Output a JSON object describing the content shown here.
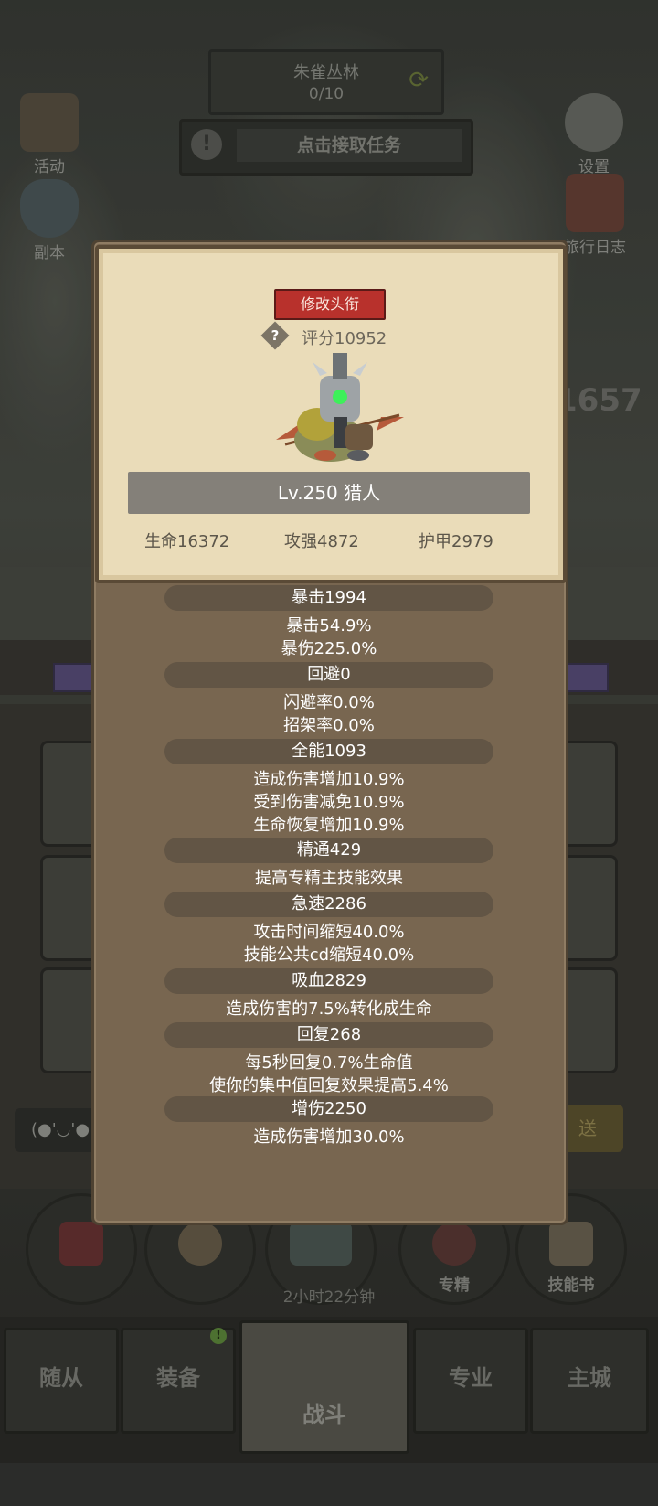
{
  "background": {
    "quest": {
      "name": "朱雀丛林",
      "progress": "0/10"
    },
    "task_button": "点击接取任务",
    "side_icons": {
      "activity": "活动",
      "dungeon": "副本",
      "settings": "设置",
      "travel_log": "旅行日志"
    },
    "partial_number": "1657",
    "chat_emoji": "(●'◡'●",
    "send_label": "送",
    "round_buttons": {
      "specialization": "专精",
      "skill_book": "技能书"
    },
    "chest_timer": "2小时22分钟",
    "bottom_nav": {
      "followers": "随从",
      "equipment": "装备",
      "battle": "战斗",
      "profession": "专业",
      "main_city": "主城"
    },
    "equipment_badge": "!"
  },
  "popup": {
    "title_button": "修改头衔",
    "score": "评分10952",
    "level_class": "Lv.250 猎人",
    "stats": {
      "hp": "生命16372",
      "attack": "攻强4872",
      "armor": "护甲2979"
    },
    "attributes": [
      {
        "name": "暴击1994",
        "details": [
          "暴击54.9%",
          "暴伤225.0%"
        ]
      },
      {
        "name": "回避0",
        "details": [
          "闪避率0.0%",
          "招架率0.0%"
        ]
      },
      {
        "name": "全能1093",
        "details": [
          "造成伤害增加10.9%",
          "受到伤害减免10.9%",
          "生命恢复增加10.9%"
        ]
      },
      {
        "name": "精通429",
        "details": [
          "提高专精主技能效果"
        ]
      },
      {
        "name": "急速2286",
        "details": [
          "攻击时间缩短40.0%",
          "技能公共cd缩短40.0%"
        ]
      },
      {
        "name": "吸血2829",
        "details": [
          "造成伤害的7.5%转化成生命"
        ]
      },
      {
        "name": "回复268",
        "details": [
          "每5秒回复0.7%生命值",
          "使你的集中值回复效果提高5.4%"
        ]
      },
      {
        "name": "增伤2250",
        "details": [
          "造成伤害增加30.0%"
        ]
      }
    ]
  }
}
